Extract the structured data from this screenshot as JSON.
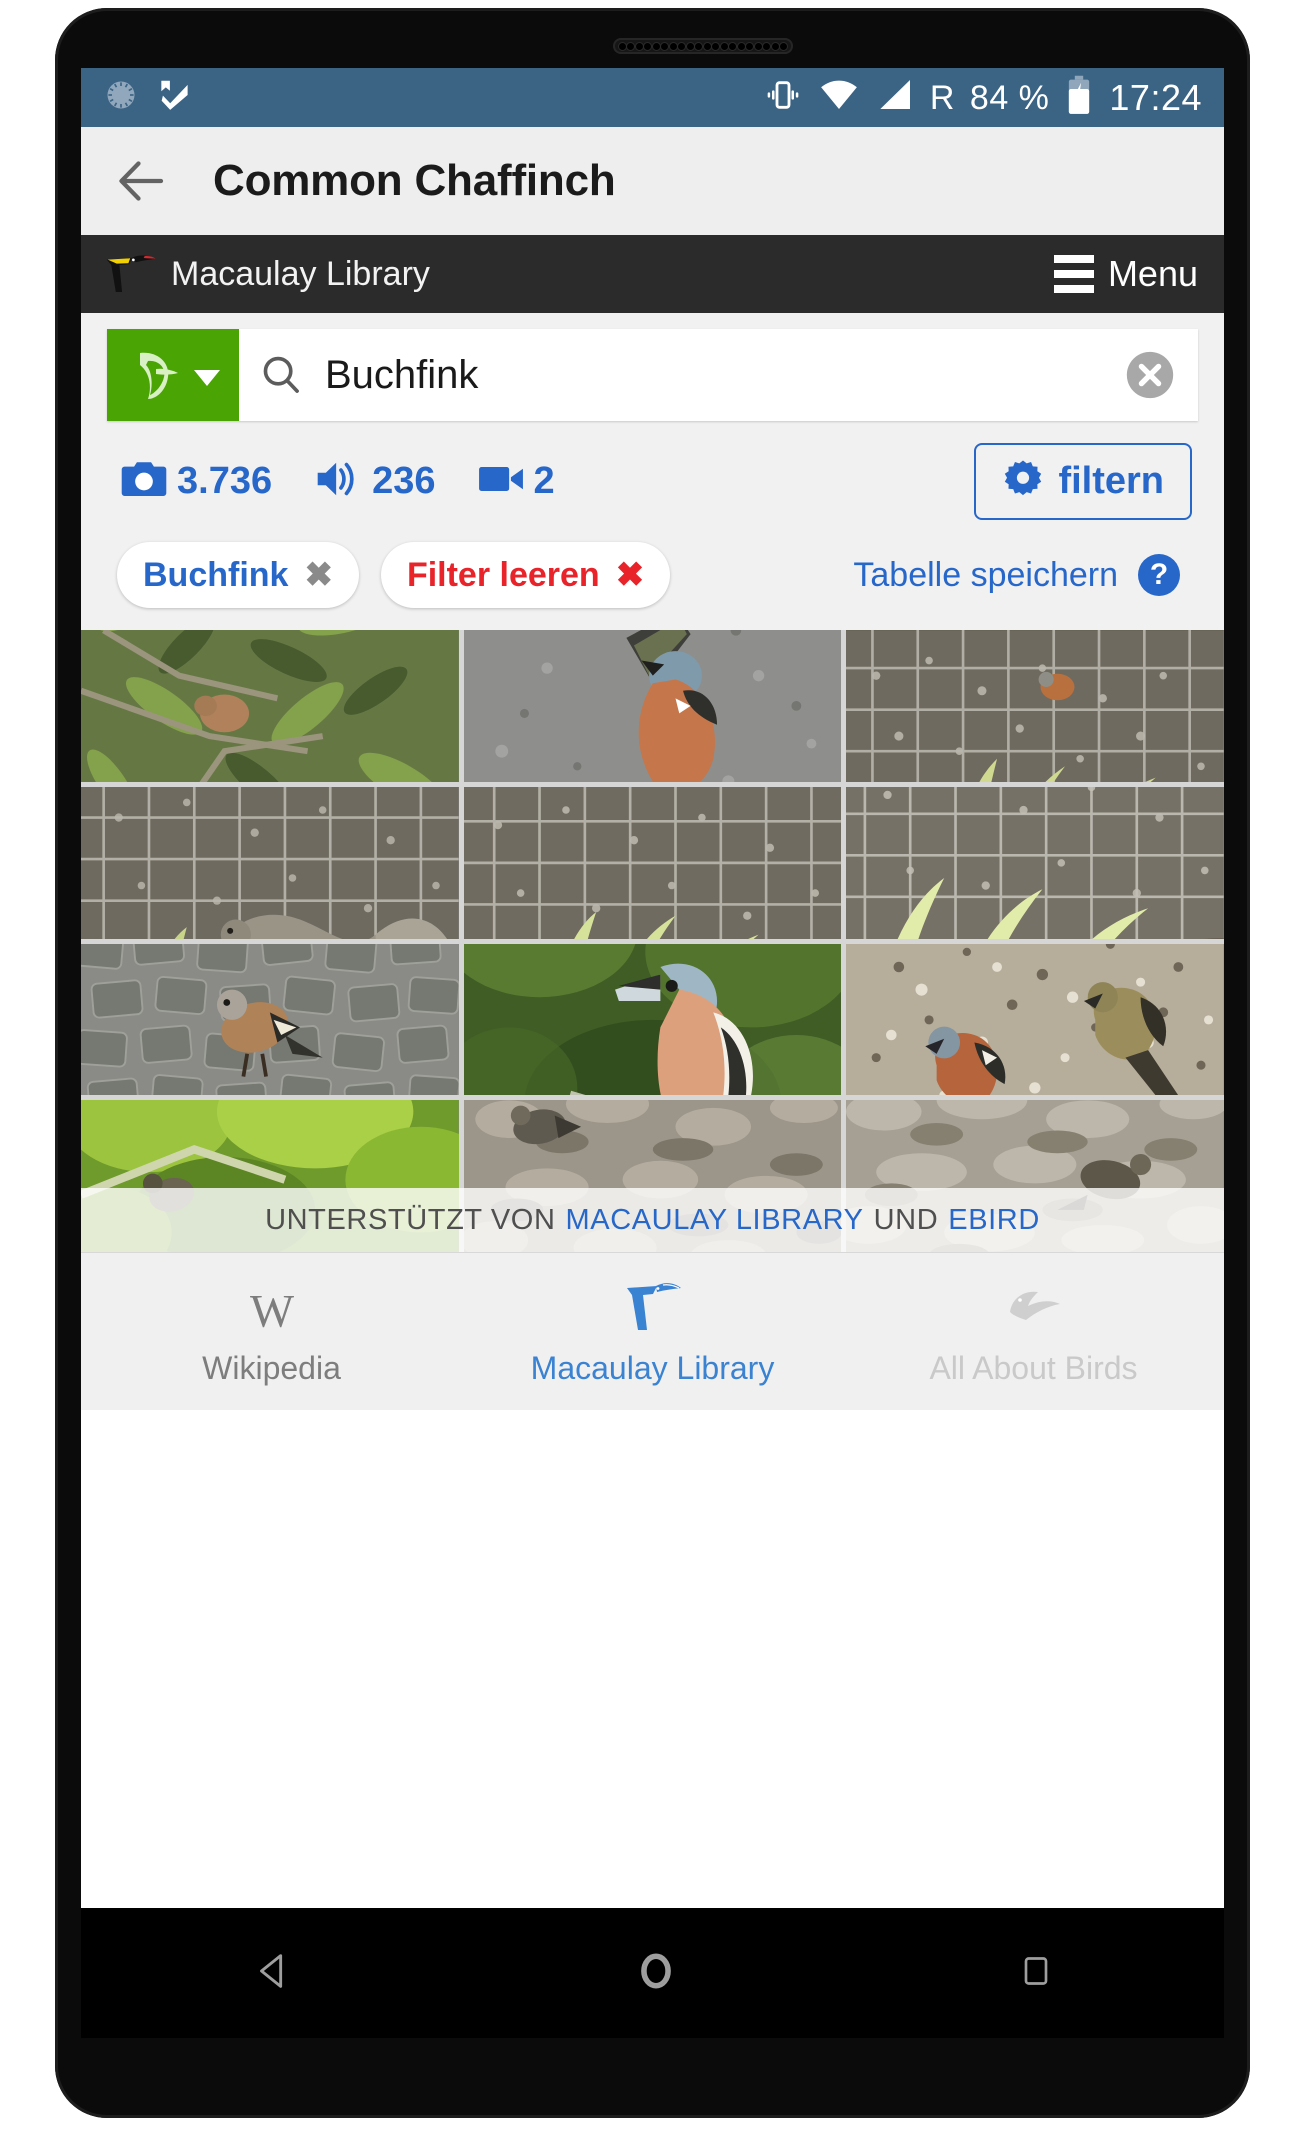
{
  "status_bar": {
    "left_icons": [
      "sync-progress-icon",
      "tasks-check-icon"
    ],
    "right_icons": [
      "vibrate-icon",
      "wifi-icon",
      "cell-signal-icon"
    ],
    "roaming": "R",
    "battery": "84 %",
    "battery_icon": "battery-charging-icon",
    "time": "17:24"
  },
  "app_bar": {
    "back_icon": "back-arrow-icon",
    "title": "Common Chaffinch"
  },
  "site_header": {
    "logo_icon": "macaulay-bird-logo-icon",
    "brand": "Macaulay Library",
    "menu_label": "Menu",
    "menu_icon": "hamburger-icon"
  },
  "search": {
    "taxon_button_icon": "green-bird-taxon-icon",
    "search_icon": "search-icon",
    "value": "Buchfink",
    "placeholder": "Buchfink",
    "clear_icon": "clear-circle-icon"
  },
  "counts": [
    {
      "icon": "camera-icon",
      "value": "3.736",
      "name": "photo-count"
    },
    {
      "icon": "audio-icon",
      "value": "236",
      "name": "audio-count"
    },
    {
      "icon": "video-icon",
      "value": "2",
      "name": "video-count"
    }
  ],
  "filter_button": {
    "icon": "gear-icon",
    "label": "filtern"
  },
  "chips": [
    {
      "label": "Buchfink",
      "x": "✖",
      "style": "blue",
      "name": "chip-buchfink"
    },
    {
      "label": "Filter leeren",
      "x": "✖",
      "style": "red",
      "name": "chip-clear-filters"
    }
  ],
  "save_table": {
    "label": "Tabelle speichern",
    "help_icon": "help-question-icon",
    "help_glyph": "?"
  },
  "gallery": {
    "rows": 4,
    "columns": 3,
    "tiles": [
      {
        "name": "photo-thumb-1",
        "alt": "chaffinch perched among green leafy branches"
      },
      {
        "name": "photo-thumb-2",
        "alt": "chaffinch standing on grey asphalt seen from above"
      },
      {
        "name": "photo-thumb-3",
        "alt": "chaffinch behind a wire mesh fence on gravel"
      },
      {
        "name": "photo-thumb-4",
        "alt": "squirrel on gravel behind wire mesh fence"
      },
      {
        "name": "photo-thumb-5",
        "alt": "gravel ground with sprouting plants behind wire mesh"
      },
      {
        "name": "photo-thumb-6",
        "alt": "wire mesh fence with pale sprouting seedlings"
      },
      {
        "name": "photo-thumb-7",
        "alt": "chaffinch on grey cobblestone pavement"
      },
      {
        "name": "photo-thumb-8",
        "alt": "chaffinch perched on a twig with green bokeh background"
      },
      {
        "name": "photo-thumb-9",
        "alt": "two chaffinches feeding on seed-strewn ground"
      },
      {
        "name": "photo-thumb-10",
        "alt": "bird among bright green sunlit foliage"
      },
      {
        "name": "photo-thumb-11",
        "alt": "bird on pale rocky gravel ground"
      },
      {
        "name": "photo-thumb-12",
        "alt": "bird on light grey stones"
      }
    ]
  },
  "credit": {
    "prefix": "UNTERSTÜTZT VON",
    "link1": "MACAULAY LIBRARY",
    "middle": "UND",
    "link2": "EBIRD"
  },
  "tabs": [
    {
      "label": "Wikipedia",
      "icon": "wikipedia-w-icon",
      "state": "inactive",
      "name": "tab-wikipedia"
    },
    {
      "label": "Macaulay Library",
      "icon": "macaulay-bird-icon",
      "state": "active",
      "name": "tab-macaulay-library"
    },
    {
      "label": "All About Birds",
      "icon": "allaboutbirds-bird-icon",
      "state": "faded",
      "name": "tab-all-about-birds"
    }
  ],
  "nav_bar": [
    {
      "icon": "android-back-icon",
      "name": "android-back-button"
    },
    {
      "icon": "android-home-icon",
      "name": "android-home-button"
    },
    {
      "icon": "android-recents-icon",
      "name": "android-recents-button"
    }
  ],
  "colors": {
    "statusbar": "#3b6384",
    "appbar": "#eeeeee",
    "siteheader": "#2b2b2b",
    "accent_blue": "#2767c9",
    "accent_red": "#e8232a",
    "taxon_green": "#4aa504",
    "tab_active": "#3a82d2"
  }
}
